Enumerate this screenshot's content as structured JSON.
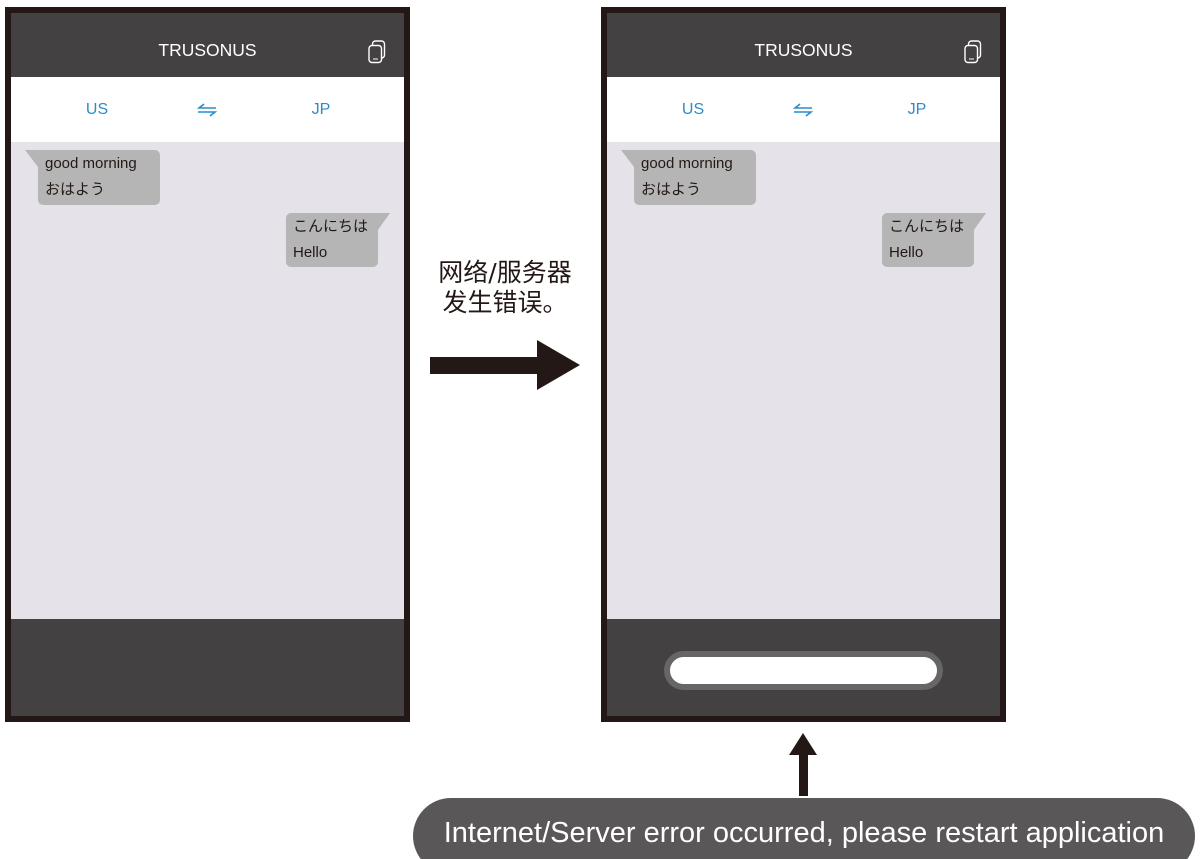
{
  "screens": [
    {
      "header": {
        "title": "TRUSONUS",
        "action_icon": "copy-icon"
      },
      "language_bar": {
        "source": "US",
        "swap_icon": "swap-icon",
        "target": "JP"
      },
      "messages": [
        {
          "lines": [
            "good morning",
            "おはよう"
          ]
        },
        {
          "lines": [
            "こんにちは",
            "Hello"
          ]
        }
      ]
    },
    {
      "header": {
        "title": "TRUSONUS",
        "action_icon": "copy-icon"
      },
      "language_bar": {
        "source": "US",
        "swap_icon": "swap-icon",
        "target": "JP"
      },
      "messages": [
        {
          "lines": [
            "good morning",
            "おはよう"
          ]
        },
        {
          "lines": [
            "こんにちは",
            "Hello"
          ]
        }
      ]
    }
  ],
  "transition": {
    "arrow_icon": "right-arrow-icon",
    "label_lines": [
      "网络/服务器",
      "发生错误。"
    ]
  },
  "callout": {
    "arrow_icon": "up-arrow-icon",
    "text": "Internet/Server error occurred, please restart application"
  },
  "colors": {
    "frame": "#231815",
    "bar": "#434142",
    "chat_background": "#e5e2e9",
    "bubble": "#b5b5b6",
    "accent": "#2b8ccb",
    "callout_background": "#595757",
    "pill_outline": "#676567"
  }
}
